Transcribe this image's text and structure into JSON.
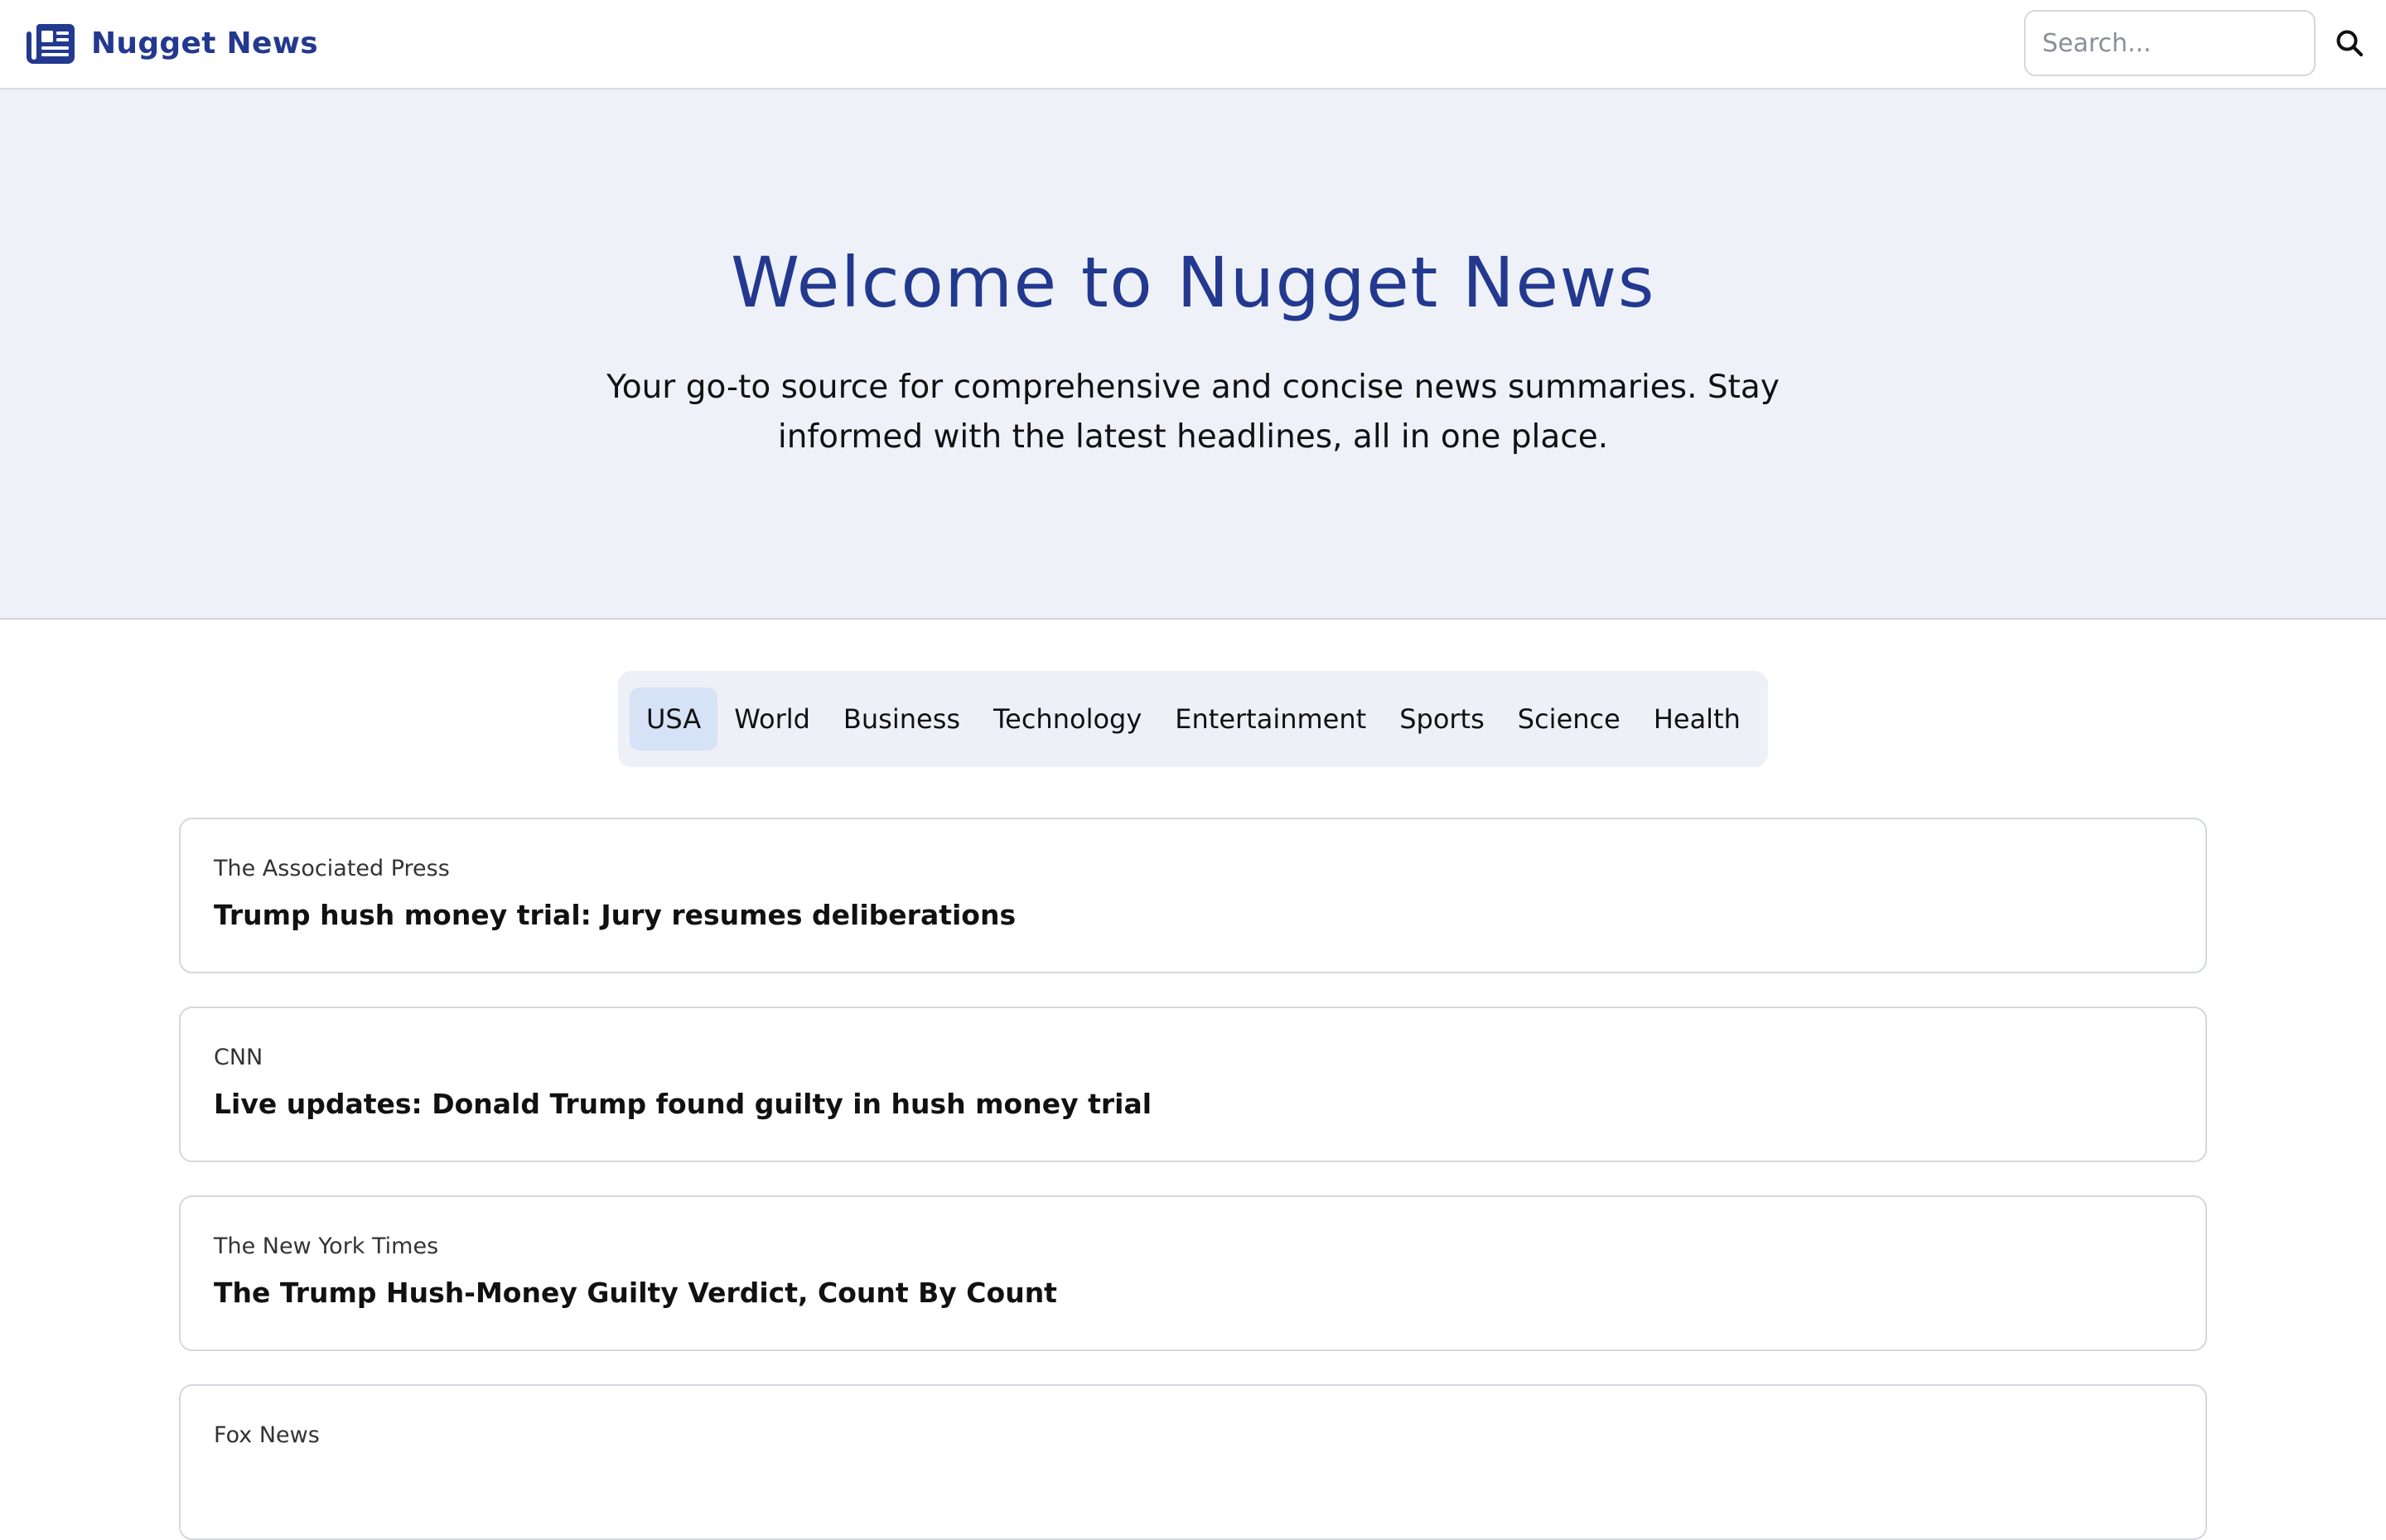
{
  "header": {
    "brand_name": "Nugget News",
    "search_placeholder": "Search..."
  },
  "hero": {
    "title": "Welcome to Nugget News",
    "subtitle": "Your go-to source for comprehensive and concise news summaries. Stay informed with the latest headlines, all in one place."
  },
  "categories": {
    "active": "USA",
    "items": [
      "USA",
      "World",
      "Business",
      "Technology",
      "Entertainment",
      "Sports",
      "Science",
      "Health"
    ]
  },
  "articles": [
    {
      "source": "The Associated Press",
      "title": "Trump hush money trial: Jury resumes deliberations"
    },
    {
      "source": "CNN",
      "title": "Live updates: Donald Trump found guilty in hush money trial"
    },
    {
      "source": "The New York Times",
      "title": "The Trump Hush-Money Guilty Verdict, Count By Count"
    },
    {
      "source": "Fox News",
      "title": ""
    }
  ],
  "colors": {
    "brand": "#23398f",
    "hero_background": "#eef1f8",
    "active_tab": "#d6e2f5"
  }
}
